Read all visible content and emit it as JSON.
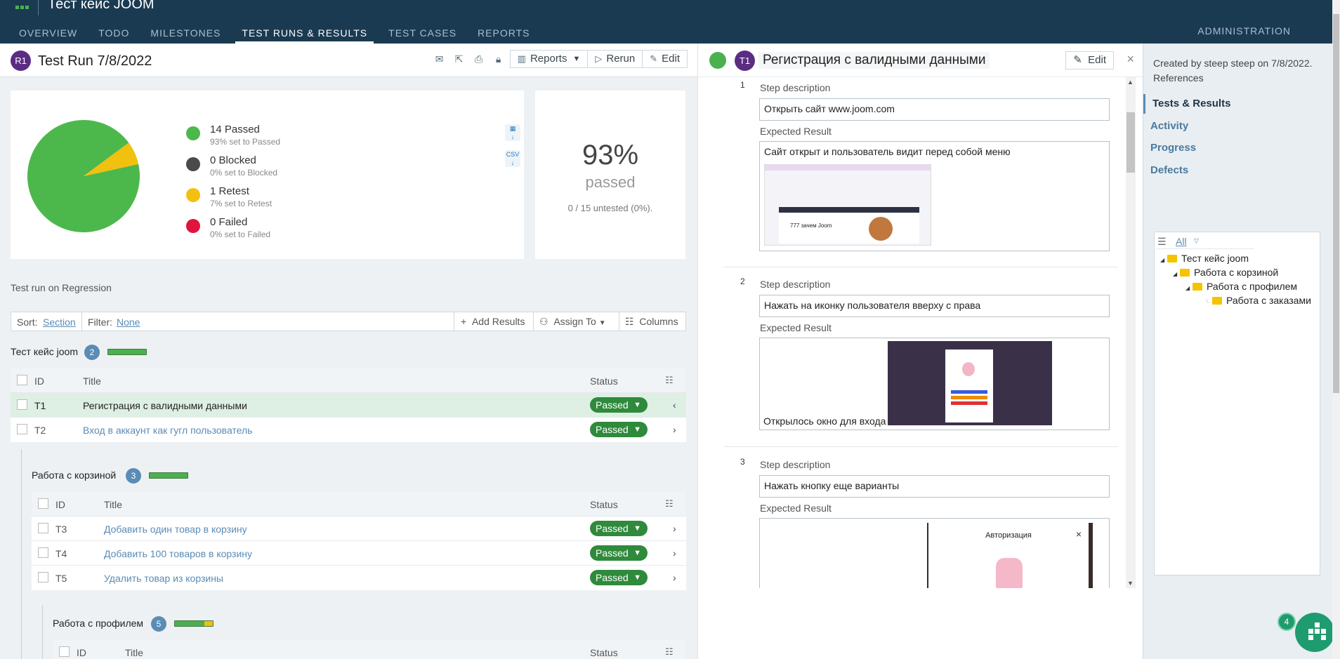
{
  "header": {
    "app_title": "Тест кейс JOOM",
    "nav": [
      "OVERVIEW",
      "TODO",
      "MILESTONES",
      "TEST RUNS & RESULTS",
      "TEST CASES",
      "REPORTS"
    ],
    "admin": "ADMINISTRATION"
  },
  "run": {
    "badge": "R1",
    "title": "Test Run 7/8/2022",
    "reports_btn": "Reports",
    "rerun_btn": "Rerun",
    "edit_btn": "Edit",
    "description": "Test run on Regression"
  },
  "stats": {
    "legend": [
      {
        "title": "14 Passed",
        "sub": "93% set to Passed",
        "color": "#4cb84c"
      },
      {
        "title": "0 Blocked",
        "sub": "0% set to Blocked",
        "color": "#4a4a4a"
      },
      {
        "title": "1 Retest",
        "sub": "7% set to Retest",
        "color": "#f2c00f"
      },
      {
        "title": "0 Failed",
        "sub": "0% set to Failed",
        "color": "#e0143c"
      }
    ],
    "pie": {
      "passed": 14,
      "blocked": 0,
      "retest": 1,
      "failed": 0
    },
    "percent": "93%",
    "percent_label": "passed",
    "untested": "0 / 15 untested (0%)."
  },
  "sortbar": {
    "sort_label": "Sort:",
    "sort_value": "Section",
    "filter_label": "Filter:",
    "filter_value": "None",
    "add_results": "Add Results",
    "assign_to": "Assign To",
    "columns": "Columns"
  },
  "table_headers": {
    "id": "ID",
    "title": "Title",
    "status": "Status"
  },
  "sections": [
    {
      "name": "Тест кейс joom",
      "count": "2",
      "rows": [
        {
          "id": "T1",
          "title": "Регистрация с валидными данными",
          "status": "Passed"
        },
        {
          "id": "T2",
          "title": "Вход в аккаунт как гугл пользователь",
          "status": "Passed"
        }
      ]
    },
    {
      "name": "Работа с корзиной",
      "count": "3",
      "rows": [
        {
          "id": "T3",
          "title": "Добавить один товар в корзину",
          "status": "Passed"
        },
        {
          "id": "T4",
          "title": "Добавить 100 товаров в корзину",
          "status": "Passed"
        },
        {
          "id": "T5",
          "title": "Удалить товар из корзины",
          "status": "Passed"
        }
      ]
    },
    {
      "name": "Работа с профилем",
      "count": "5",
      "rows": []
    }
  ],
  "case": {
    "badge": "T1",
    "title": "Регистрация с валидными данными",
    "edit_btn": "Edit",
    "step_desc_label": "Step description",
    "expected_label": "Expected Result",
    "steps": [
      {
        "num": "1",
        "desc": "Открыть сайт www.joom.com",
        "expected": "Сайт открыт и пользователь видит перед собой меню"
      },
      {
        "num": "2",
        "desc": "Нажать на иконку пользователя вверху с права",
        "expected": "Открылось окно для входа"
      },
      {
        "num": "3",
        "desc": "Нажать кнопку еще варианты",
        "expected": ""
      }
    ],
    "shot1_text": "777 зачем Joom",
    "shot3_title": "Авторизация"
  },
  "right": {
    "meta": "Created by steep steep on 7/8/2022. References",
    "tabs": [
      "Tests & Results",
      "Activity",
      "Progress",
      "Defects"
    ],
    "tree_filter": "All",
    "tree": [
      "Тест кейс joom",
      "Работа с корзиной",
      "Работа с профилем",
      "Работа с заказами"
    ]
  },
  "fab_badge": "4"
}
